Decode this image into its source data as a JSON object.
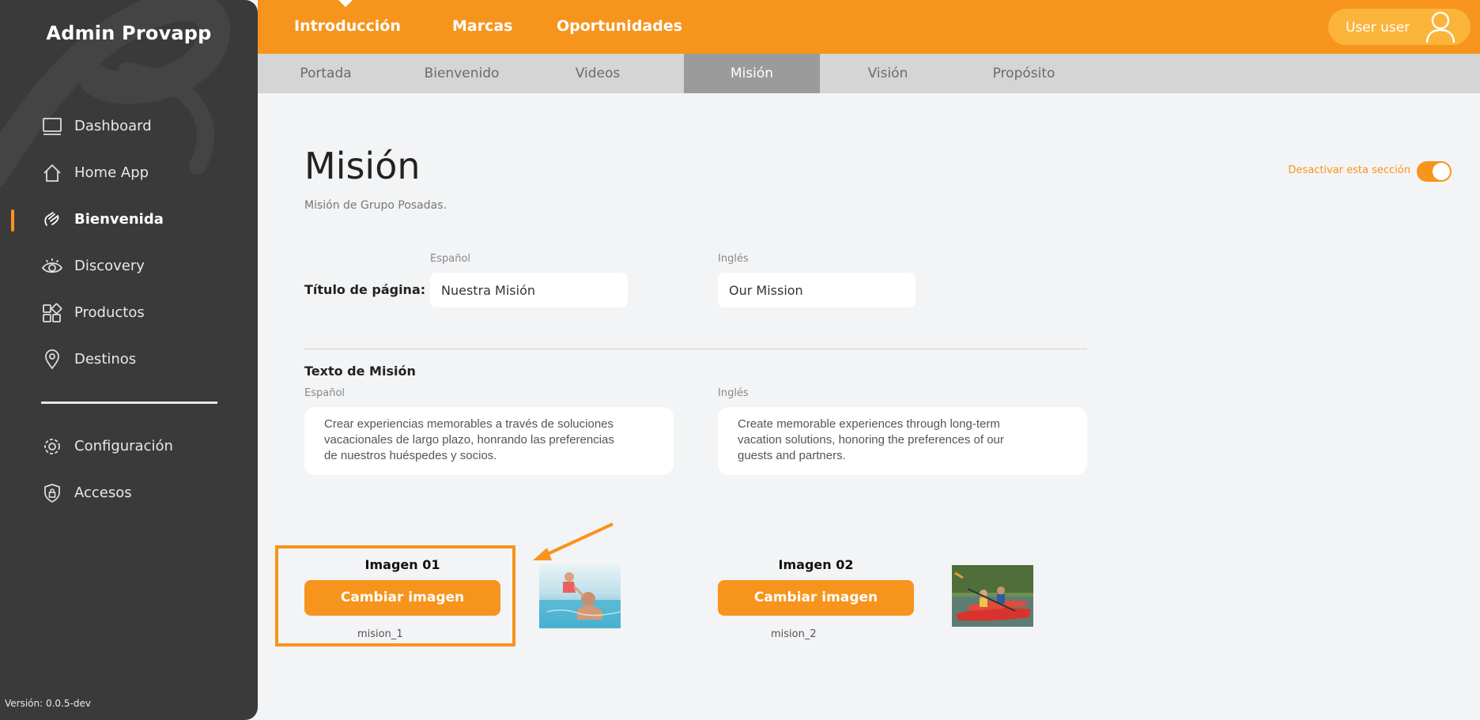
{
  "sidebar": {
    "brand": "Admin Provapp",
    "items": [
      {
        "label": "Dashboard",
        "icon": "monitor-icon"
      },
      {
        "label": "Home App",
        "icon": "home-icon"
      },
      {
        "label": "Bienvenida",
        "icon": "hand-wave-icon",
        "active": true
      },
      {
        "label": "Discovery",
        "icon": "eye-icon"
      },
      {
        "label": "Productos",
        "icon": "grid-shapes-icon"
      },
      {
        "label": "Destinos",
        "icon": "location-pin-icon"
      },
      {
        "label": "Configuración",
        "icon": "gear-icon"
      },
      {
        "label": "Accesos",
        "icon": "shield-lock-icon"
      }
    ],
    "version": "Versión: 0.0.5-dev"
  },
  "topbar": {
    "tabs": [
      "Introducción",
      "Marcas",
      "Oportunidades"
    ],
    "user_name": "User user"
  },
  "subtabs": {
    "items": [
      "Portada",
      "Bienvenido",
      "Videos",
      "Misión",
      "Visión",
      "Propósito"
    ],
    "active": "Misión"
  },
  "main": {
    "title": "Misión",
    "subtitle": "Misión de Grupo Posadas.",
    "toggle_label": "Desactivar esta sección",
    "toggle_on": true,
    "page_title_field": {
      "label": "Título de página:",
      "es_label": "Español",
      "en_label": "Inglés",
      "es_value": "Nuestra Misión",
      "en_value": "Our Mission"
    },
    "mission_text": {
      "label": "Texto de Misión",
      "es_label": "Español",
      "en_label": "Inglés",
      "es_line1": "Crear experiencias memorables a través de soluciones",
      "es_line2": "vacacionales de largo plazo, honrando las preferencias",
      "es_line3": "de nuestros huéspedes y socios.",
      "en_line1": "Create memorable experiences through long-term",
      "en_line2": "vacation solutions, honoring the preferences of our",
      "en_line3": "guests and partners."
    },
    "images": [
      {
        "title": "Imagen 01",
        "button": "Cambiar imagen",
        "file": "mision_1"
      },
      {
        "title": "Imagen 02",
        "button": "Cambiar imagen",
        "file": "mision_2"
      }
    ]
  },
  "colors": {
    "accent": "#f7941d",
    "sidebar_bg": "#3a3a3a",
    "subbar_bg": "#d5d5d5",
    "active_subtab": "#9b9b9b"
  }
}
